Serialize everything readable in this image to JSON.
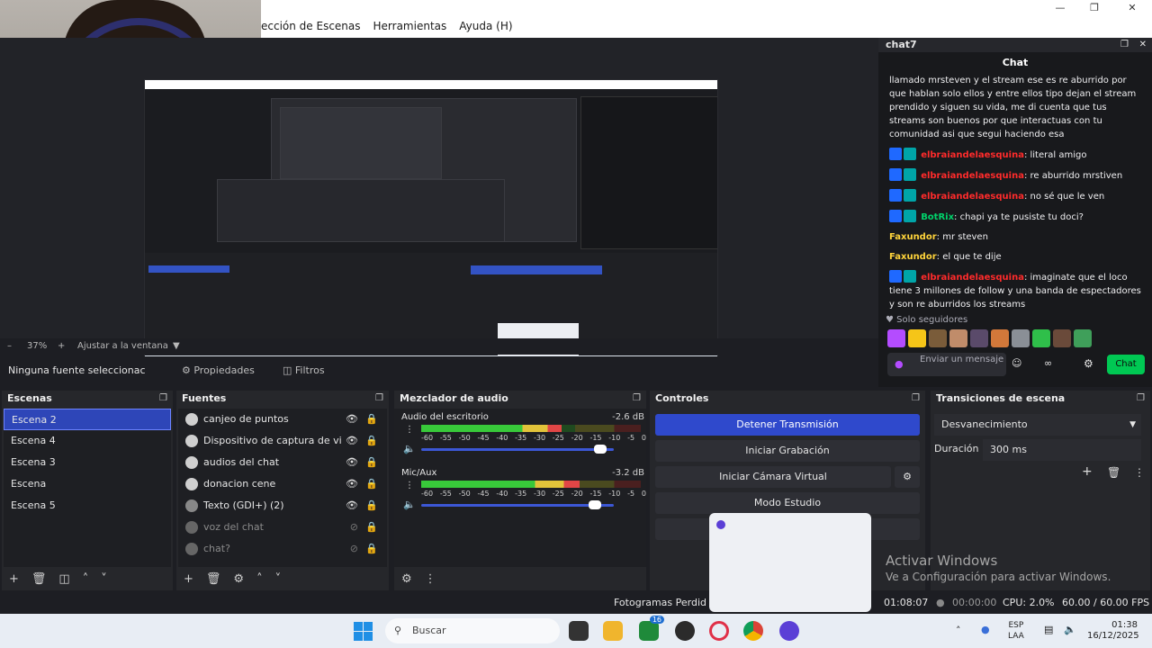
{
  "menu": {
    "items": [
      "ección de Escenas",
      "Herramientas",
      "Ayuda (H)"
    ],
    "window_controls": [
      "minimize",
      "restore",
      "close"
    ]
  },
  "preview": {
    "zoom": "37%",
    "fit_label": "Ajustar a la ventana",
    "nested_overlay": [
      "Activar Windows",
      "Ve a Configuración para activar Windows."
    ]
  },
  "chat_dock": {
    "title": "chat7",
    "header": "Chat",
    "messages": [
      {
        "user": "",
        "text": "llamado mrsteven y el stream ese es re aburrido por que hablan solo ellos y entre ellos tipo dejan el stream prendido y siguen su vida, me di cuenta que tus streams son buenos por que interactuas con tu comunidad asi que segui haciendo esa",
        "color": "#efeff1",
        "badges": false
      },
      {
        "user": "elbraiandelaesquina",
        "text": ": literal amigo",
        "color": "#ff2b2b",
        "badges": true
      },
      {
        "user": "elbraiandelaesquina",
        "text": ": re aburrido mrstiven",
        "color": "#ff2b2b",
        "badges": true
      },
      {
        "user": "elbraiandelaesquina",
        "text": ": no sé que le ven",
        "color": "#ff2b2b",
        "badges": true
      },
      {
        "user": "BotRix",
        "text": ": chapi ya te pusiste tu doci?",
        "color": "#00d26a",
        "badges": true
      },
      {
        "user": "Faxundor",
        "text": ": mr steven",
        "color": "#ffd43b",
        "badges": false
      },
      {
        "user": "Faxundor",
        "text": ": el que te dije",
        "color": "#ffd43b",
        "badges": false
      },
      {
        "user": "elbraiandelaesquina",
        "text": ": imaginate que el loco tiene 3 millones de follow y una banda de espectadores y son re aburridos los streams",
        "color": "#ff2b2b",
        "badges": true
      }
    ],
    "followers_only": "Solo seguidores",
    "input_placeholder": "Enviar un mensaje",
    "send_label": "Chat"
  },
  "toolbar": {
    "no_source": "Ninguna fuente seleccionac",
    "properties": "Propiedades",
    "filters": "Filtros"
  },
  "scenes": {
    "title": "Escenas",
    "items": [
      "Escena 2",
      "Escena 4",
      "Escena 3",
      "Escena",
      "Escena 5"
    ],
    "selected": "Escena 2"
  },
  "sources": {
    "title": "Fuentes",
    "items": [
      {
        "name": "canjeo de puntos",
        "visible": true
      },
      {
        "name": "Dispositivo de captura de vi",
        "visible": true
      },
      {
        "name": "audios del chat",
        "visible": true
      },
      {
        "name": "donacion cene",
        "visible": true
      },
      {
        "name": "Texto (GDI+) (2)",
        "visible": true
      },
      {
        "name": "voz del chat",
        "visible": false
      },
      {
        "name": "chat?",
        "visible": false
      }
    ]
  },
  "mixer": {
    "title": "Mezclador de audio",
    "channels": [
      {
        "name": "Audio del escritorio",
        "db": "-2.6 dB",
        "level": 0.64,
        "volume": 0.93
      },
      {
        "name": "Mic/Aux",
        "db": "-3.2 dB",
        "level": 0.72,
        "volume": 0.9
      }
    ],
    "ticks": [
      "-60",
      "-55",
      "-50",
      "-45",
      "-40",
      "-35",
      "-30",
      "-25",
      "-20",
      "-15",
      "-10",
      "-5",
      "0"
    ]
  },
  "controls": {
    "title": "Controles",
    "stop_stream": "Detener Transmisión",
    "start_recording": "Iniciar Grabación",
    "start_virtual_cam": "Iniciar Cámara Virtual",
    "studio_mode": "Modo Estudio"
  },
  "transitions": {
    "title": "Transiciones de escena",
    "selected": "Desvanecimiento",
    "duration_label": "Duración",
    "duration_value": "300 ms"
  },
  "status": {
    "dropped_frames": "Fotogramas Perdid",
    "stream_time": "01:08:07",
    "rec_time": "00:00:00",
    "cpu": "CPU: 2.0%",
    "fps": "60.00 / 60.00 FPS"
  },
  "activate_windows": {
    "line1": "Activar Windows",
    "line2": "Ve a Configuración para activar Windows."
  },
  "taskbar": {
    "search_label": "Buscar",
    "lang_top": "ESP",
    "lang_bottom": "LAA",
    "time": "01:38",
    "date": "16/12/2025",
    "badge_count": "16"
  }
}
